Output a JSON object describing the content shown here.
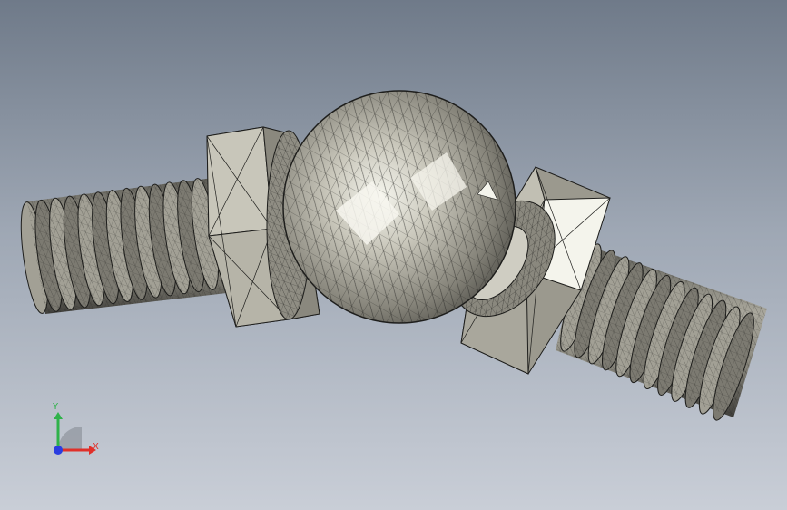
{
  "viewport": {
    "model_name": "ball-joint-assembly",
    "render_style": "shaded-with-mesh-edges",
    "background_gradient": [
      "#6f7a89",
      "#9ea7b4",
      "#c9ced7"
    ]
  },
  "model": {
    "parts": [
      {
        "name": "threaded-stud-left",
        "icon": "threaded-rod"
      },
      {
        "name": "hex-nut-left",
        "icon": "hex-nut"
      },
      {
        "name": "washer-left",
        "icon": "washer"
      },
      {
        "name": "ball-sphere",
        "icon": "sphere"
      },
      {
        "name": "socket-neck",
        "icon": "torus"
      },
      {
        "name": "hex-nut-right",
        "icon": "hex-nut"
      },
      {
        "name": "threaded-stud-right",
        "icon": "threaded-rod"
      }
    ],
    "colors": {
      "metal_light": "#f4f4ec",
      "metal_mid": "#a9a79c",
      "metal_dark": "#5b5a53",
      "mesh_line": "#1e1e1c"
    }
  },
  "triad": {
    "x_label": "X",
    "y_label": "Y",
    "x_color": "#e0302a",
    "y_color": "#2fb24a",
    "z_color": "#2a3de0"
  }
}
